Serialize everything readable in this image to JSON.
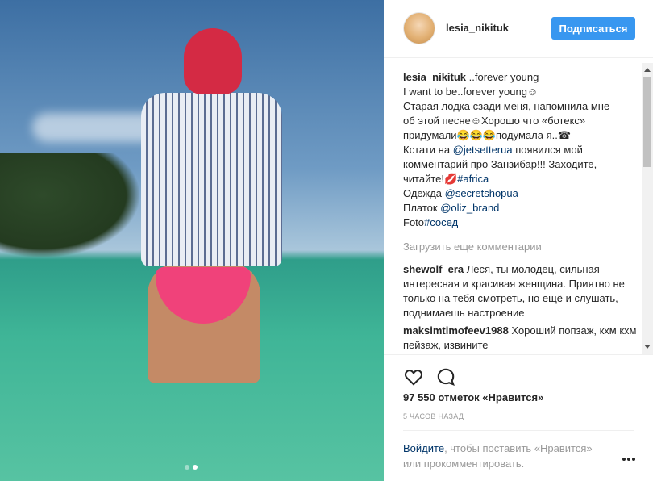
{
  "post": {
    "username": "lesia_nikituk",
    "follow_label": "Подписаться",
    "caption": {
      "author": "lesia_nikituk",
      "line1": " ..forever young",
      "line2": "I want to be..forever young☺",
      "line3": "Старая лодка сзади меня, напомнила мне",
      "line4": "об этой песне☺Хорошо что «ботекс»",
      "line5": "придумали😂😂😂подумала я..☎",
      "line6_pre": "Кстати на ",
      "line6_link": "@jetsetterua",
      "line6_post": " появился мой",
      "line7": "комментарий про Занзибар!!! Заходите,",
      "line8_pre": "читайте!💋",
      "line8_link": "#africa",
      "line9_pre": "Одежда ",
      "line9_link": "@secretshopua",
      "line10_pre": "Платок ",
      "line10_link": "@oliz_brand",
      "line11_pre": "Foto",
      "line11_link": "#сосед"
    },
    "load_more": "Загрузить еще комментарии",
    "comments": [
      {
        "author": "shewolf_era",
        "text": " Леся, ты молодец, сильная интересная и красивая женщина. Приятно не только на тебя смотреть, но ещё и слушать, поднимаешь настроение"
      },
      {
        "author": "maksimtimofeev1988",
        "text": " Хороший попзаж, кхм кхм пейзаж, извините"
      }
    ],
    "likes": "97 550 отметок «Нравится»",
    "time": "5 ЧАСОВ НАЗАД",
    "login_link": "Войдите",
    "login_text": ", чтобы поставить «Нравится» или прокомментировать.",
    "carousel": {
      "count": 2,
      "active_index": 1
    }
  },
  "icons": {
    "like": "heart-outline-icon",
    "comment": "speech-bubble-icon",
    "more": "more-options-icon"
  },
  "colors": {
    "accent": "#3897f0",
    "link": "#003569",
    "muted": "#999999",
    "text": "#262626"
  }
}
